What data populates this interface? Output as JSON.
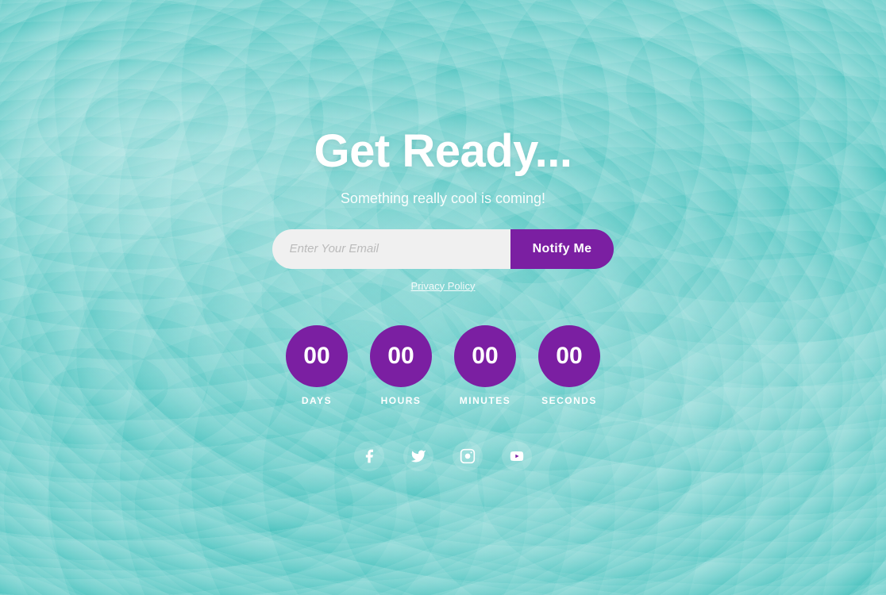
{
  "background": {
    "color": "#3dbfbb"
  },
  "headline": "Get Ready...",
  "subtitle": "Something really cool is coming!",
  "email_input": {
    "placeholder": "Enter Your Email"
  },
  "notify_button": {
    "label": "Notify Me"
  },
  "privacy_label": "Privacy Policy",
  "countdown": {
    "days": {
      "value": "00",
      "label": "DAYS"
    },
    "hours": {
      "value": "00",
      "label": "HOURS"
    },
    "minutes": {
      "value": "00",
      "label": "MINUTES"
    },
    "seconds": {
      "value": "00",
      "label": "SECONDS"
    }
  },
  "social": {
    "facebook": "facebook-icon",
    "twitter": "twitter-icon",
    "instagram": "instagram-icon",
    "youtube": "youtube-icon"
  }
}
